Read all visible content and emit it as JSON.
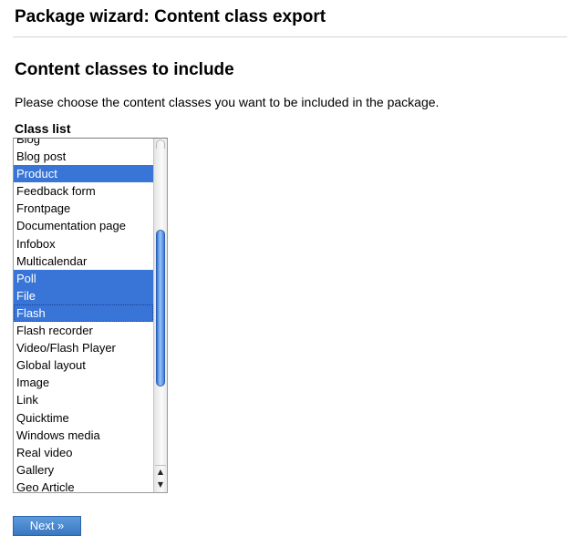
{
  "page": {
    "title": "Package wizard: Content class export"
  },
  "section": {
    "heading": "Content classes to include",
    "description": "Please choose the content classes you want to be included in the package."
  },
  "class_list": {
    "label": "Class list",
    "options": [
      {
        "label": "Blog",
        "selected": false
      },
      {
        "label": "Blog post",
        "selected": false
      },
      {
        "label": "Product",
        "selected": true
      },
      {
        "label": "Feedback form",
        "selected": false
      },
      {
        "label": "Frontpage",
        "selected": false
      },
      {
        "label": "Documentation page",
        "selected": false
      },
      {
        "label": "Infobox",
        "selected": false
      },
      {
        "label": "Multicalendar",
        "selected": false
      },
      {
        "label": "Poll",
        "selected": true
      },
      {
        "label": "File",
        "selected": true
      },
      {
        "label": "Flash",
        "selected": true,
        "focused": true
      },
      {
        "label": "Flash recorder",
        "selected": false
      },
      {
        "label": "Video/Flash Player",
        "selected": false
      },
      {
        "label": "Global layout",
        "selected": false
      },
      {
        "label": "Image",
        "selected": false
      },
      {
        "label": "Link",
        "selected": false
      },
      {
        "label": "Quicktime",
        "selected": false
      },
      {
        "label": "Windows media",
        "selected": false
      },
      {
        "label": "Real video",
        "selected": false
      },
      {
        "label": "Gallery",
        "selected": false
      },
      {
        "label": "Geo Article",
        "selected": false
      }
    ],
    "scroll_up_icon": "scroll-up-arrow-icon",
    "scroll_down_icon": "scroll-down-arrow-icon",
    "selection_color": "#3875d7"
  },
  "actions": {
    "next_label": "Next »",
    "button_color": "#3a77c2"
  }
}
